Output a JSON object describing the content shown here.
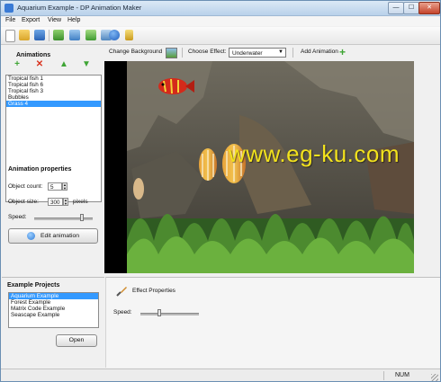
{
  "window": {
    "title": "Aquarium Example - DP Animation Maker",
    "controls": {
      "minimize": "—",
      "maximize": "☐",
      "close": "✕"
    }
  },
  "menu": [
    "File",
    "Export",
    "View",
    "Help"
  ],
  "toolbar": {
    "icons": [
      "new-document-icon",
      "open-folder-icon",
      "save-icon",
      "export-image-icon",
      "export-video-icon",
      "export-html-icon",
      "export-swf-icon",
      "info-icon",
      "key-icon"
    ]
  },
  "animations": {
    "title": "Animations",
    "items": [
      "Tropical fish 1",
      "Tropical fish 6",
      "Tropical fish 3",
      "Bubbles",
      "Grass 4"
    ],
    "selected_index": 4
  },
  "properties": {
    "title": "Animation properties",
    "object_count_label": "Object count:",
    "object_count_value": "5",
    "object_size_label": "Object size:",
    "object_size_value": "300",
    "object_size_unit": "pixels",
    "speed_label": "Speed:",
    "speed_level": 0.82,
    "edit_button": "Edit animation"
  },
  "top_controls": {
    "change_background": "Change Background",
    "choose_effect_label": "Choose Effect:",
    "effect_value": "Underwater",
    "add_animation": "Add Animation"
  },
  "preview": {
    "watermark": "www.eg-ku.com"
  },
  "example_projects": {
    "title": "Example Projects",
    "items": [
      "Aquarium Example",
      "Forest Example",
      "Matrix Code Example",
      "Seascape Example"
    ],
    "selected_index": 0,
    "open_button": "Open"
  },
  "effect_properties": {
    "title": "Effect Properties",
    "speed_label": "Speed:",
    "speed_level": 0.32
  },
  "status": {
    "num": "NUM"
  },
  "colors": {
    "selection": "#3399ff",
    "watermark": "#f2e21d",
    "green": "#3fa535",
    "red": "#d9331f"
  }
}
